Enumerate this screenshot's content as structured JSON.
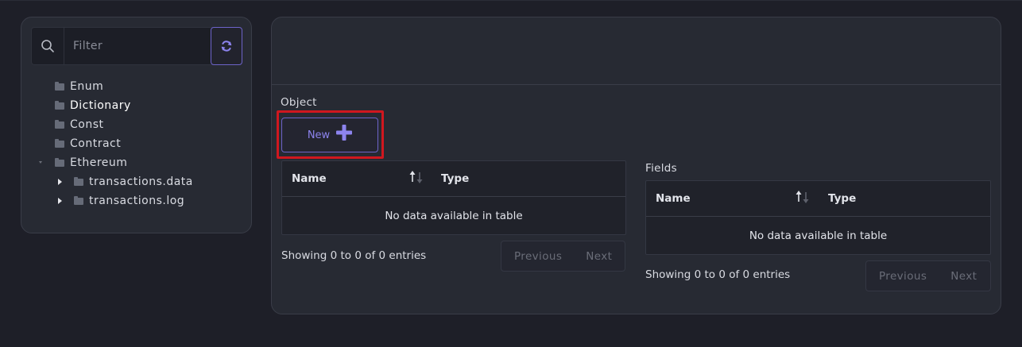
{
  "filter": {
    "placeholder": "Filter",
    "icons": {
      "search": "search-icon",
      "refresh": "refresh-icon"
    }
  },
  "tree": {
    "items": [
      {
        "label": "Enum"
      },
      {
        "label": "Dictionary",
        "selected": true
      },
      {
        "label": "Const"
      },
      {
        "label": "Contract"
      },
      {
        "label": "Ethereum",
        "expanded": true
      },
      {
        "label": "transactions.data"
      },
      {
        "label": "transactions.log"
      }
    ]
  },
  "object_section": {
    "label": "Object",
    "new_button_label": "New",
    "table": {
      "columns": [
        "Name",
        "Type"
      ],
      "empty_message": "No data available in table",
      "info": "Showing 0 to 0 of 0 entries",
      "previous_label": "Previous",
      "next_label": "Next"
    }
  },
  "fields_section": {
    "label": "Fields",
    "table": {
      "columns": [
        "Name",
        "Type"
      ],
      "empty_message": "No data available in table",
      "info": "Showing 0 to 0 of 0 entries",
      "previous_label": "Previous",
      "next_label": "Next"
    }
  },
  "colors": {
    "background": "#1e1f28",
    "panel": "#272a33",
    "accent": "#6d63c9",
    "highlight": "#d0171f"
  }
}
